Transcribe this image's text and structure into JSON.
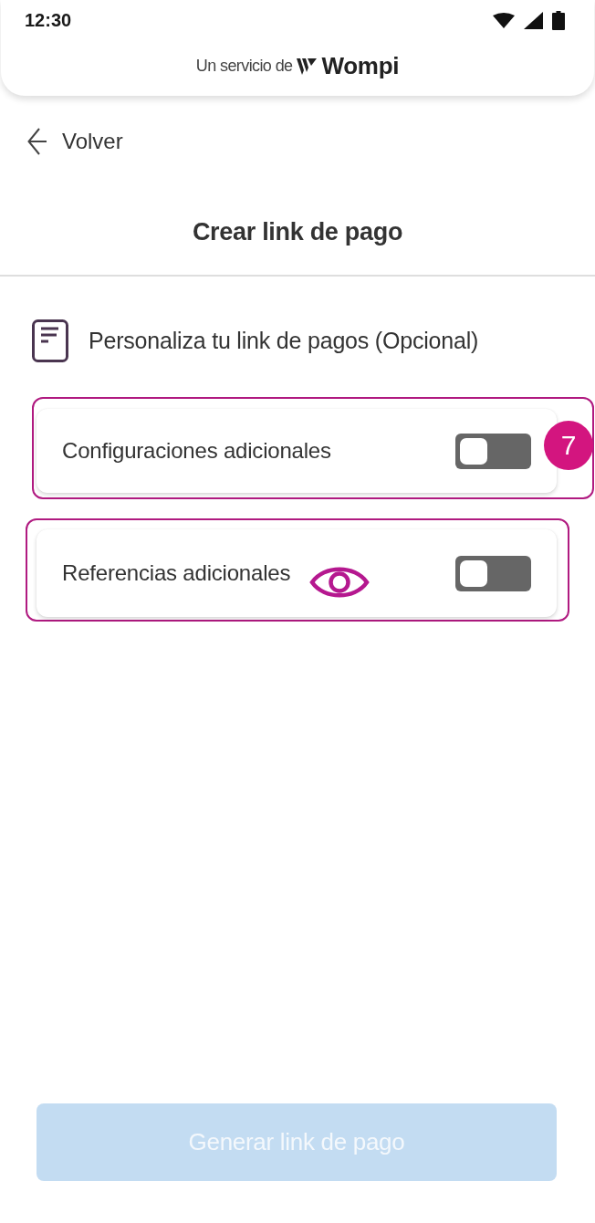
{
  "status_bar": {
    "time": "12:30"
  },
  "header": {
    "service_text": "Un servicio de",
    "brand": "Wompi"
  },
  "back_link": {
    "label": "Volver"
  },
  "page_title": "Crear link de pago",
  "section": {
    "title": "Personaliza tu link de pagos (Opcional)"
  },
  "options": [
    {
      "label": "Configuraciones adicionales",
      "on": false,
      "highlighted": true,
      "annotation": {
        "kind": "badge",
        "text": "7"
      }
    },
    {
      "label": "Referencias adicionales",
      "on": false,
      "highlighted": true,
      "annotation": {
        "kind": "eye"
      }
    }
  ],
  "submit_button": {
    "label": "Generar link de pago",
    "disabled": true
  }
}
